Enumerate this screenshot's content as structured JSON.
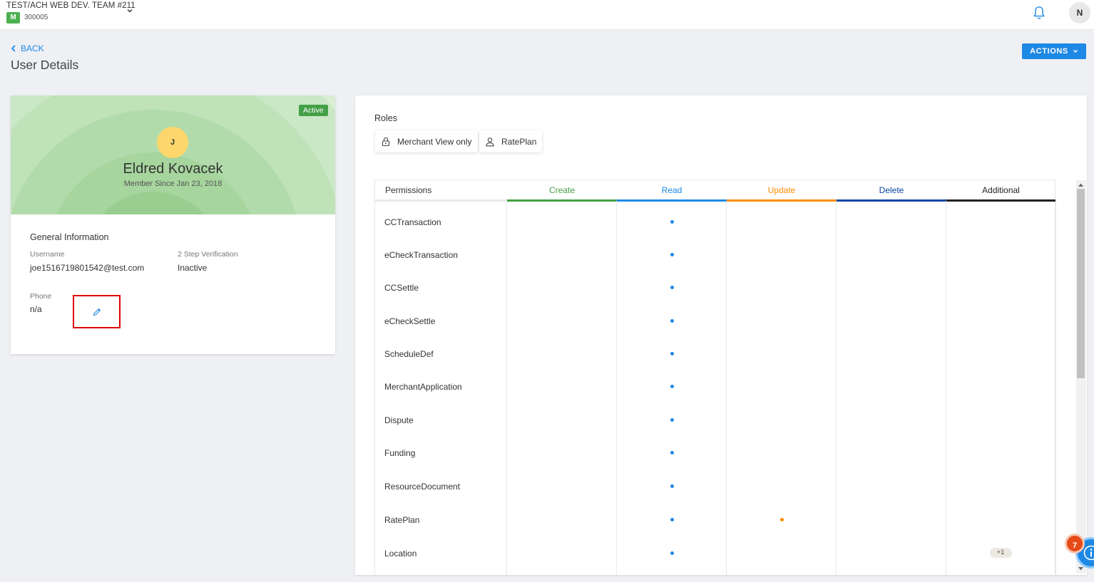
{
  "topbar": {
    "org_name": "TEST/ACH WEB DEV. TEAM #211",
    "org_badge": "M",
    "org_id": "300005",
    "user_initial": "N"
  },
  "header": {
    "back_label": "BACK",
    "title": "User Details",
    "actions_label": "ACTIONS"
  },
  "profile": {
    "status": "Active",
    "initial": "J",
    "name": "Eldred Kovacek",
    "member_since": "Member Since Jan 23, 2018",
    "section_title": "General Information",
    "username_label": "Username",
    "username_value": "joe1516719801542@test.com",
    "two_step_label": "2 Step Verification",
    "two_step_value": "Inactive",
    "phone_label": "Phone",
    "phone_value": "n/a"
  },
  "roles": {
    "title": "Roles",
    "items": [
      {
        "label": "Merchant View only",
        "icon": "lock-icon"
      },
      {
        "label": "RatePlan",
        "icon": "user-icon"
      }
    ]
  },
  "permissions": {
    "columns": [
      {
        "label": "Permissions",
        "color": "#333333"
      },
      {
        "label": "Create",
        "color": "#43a047"
      },
      {
        "label": "Read",
        "color": "#1e88e5"
      },
      {
        "label": "Update",
        "color": "#fb8c00"
      },
      {
        "label": "Delete",
        "color": "#0d47a1"
      },
      {
        "label": "Additional",
        "color": "#222222"
      }
    ],
    "rows": [
      {
        "name": "CCTransaction",
        "read": true,
        "update": false,
        "additional": ""
      },
      {
        "name": "eCheckTransaction",
        "read": true,
        "update": false,
        "additional": ""
      },
      {
        "name": "CCSettle",
        "read": true,
        "update": false,
        "additional": ""
      },
      {
        "name": "eCheckSettle",
        "read": true,
        "update": false,
        "additional": ""
      },
      {
        "name": "ScheduleDef",
        "read": true,
        "update": false,
        "additional": ""
      },
      {
        "name": "MerchantApplication",
        "read": true,
        "update": false,
        "additional": ""
      },
      {
        "name": "Dispute",
        "read": true,
        "update": false,
        "additional": ""
      },
      {
        "name": "Funding",
        "read": true,
        "update": false,
        "additional": ""
      },
      {
        "name": "ResourceDocument",
        "read": true,
        "update": false,
        "additional": ""
      },
      {
        "name": "RatePlan",
        "read": true,
        "update": true,
        "additional": ""
      },
      {
        "name": "Location",
        "read": true,
        "update": false,
        "additional": "+1"
      }
    ]
  },
  "help": {
    "count": "7"
  }
}
